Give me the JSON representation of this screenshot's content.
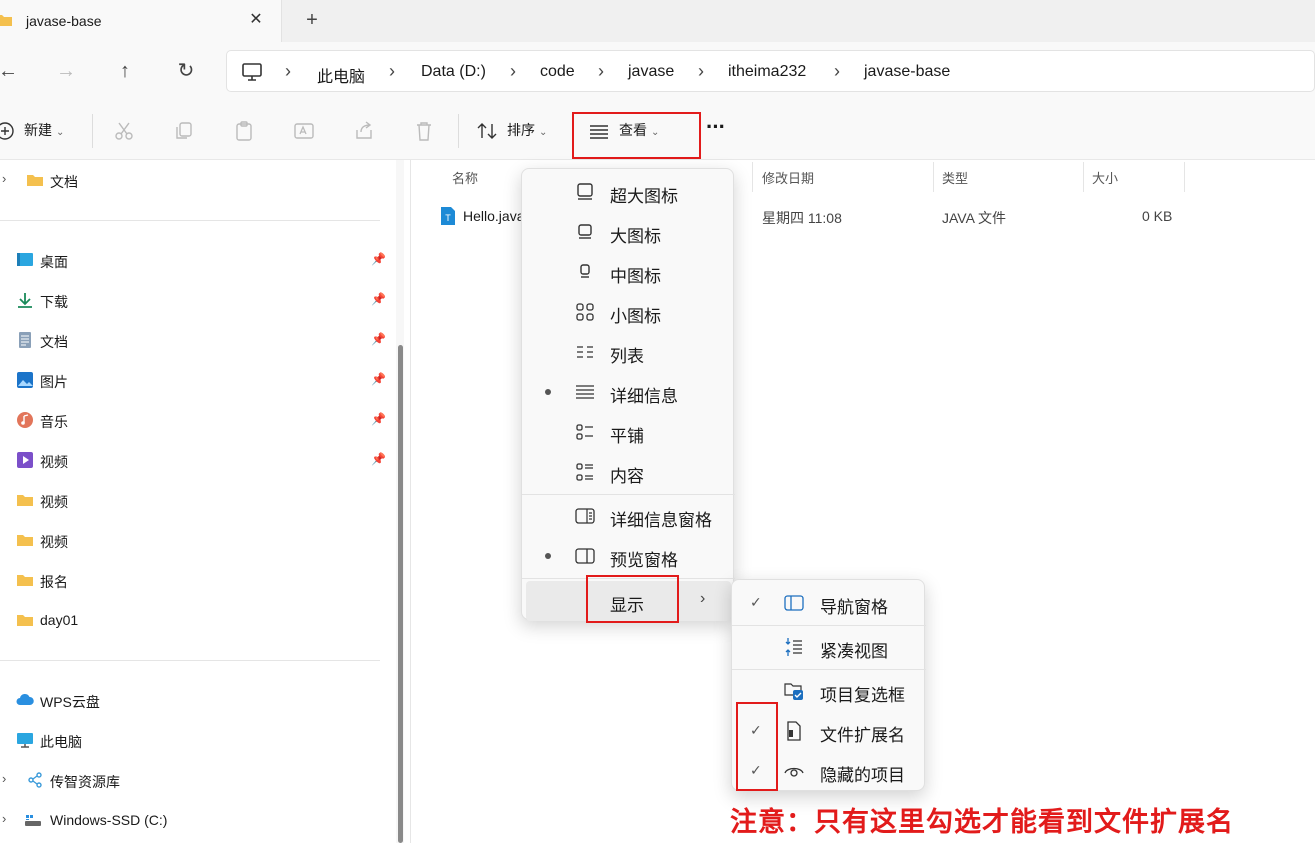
{
  "window": {
    "tab_title": "javase-base",
    "tab_close": "✕",
    "tab_new": "+"
  },
  "nav": {
    "back": "←",
    "forward": "→",
    "up": "↑",
    "refresh": "↻",
    "breadcrumbs": [
      "此电脑",
      "Data (D:)",
      "code",
      "javase",
      "itheima232",
      "javase-base"
    ],
    "separator": "›"
  },
  "toolbar": {
    "new_label": "新建",
    "sort_label": "排序",
    "view_label": "查看",
    "more": "···",
    "chevron": "⌄"
  },
  "sidebar": {
    "items": [
      {
        "label": "文档",
        "icon": "folder-icon"
      },
      {
        "label": "桌面",
        "icon": "desktop-icon"
      },
      {
        "label": "下载",
        "icon": "download-icon"
      },
      {
        "label": "文档",
        "icon": "document-icon"
      },
      {
        "label": "图片",
        "icon": "pictures-icon"
      },
      {
        "label": "音乐",
        "icon": "music-icon"
      },
      {
        "label": "视频",
        "icon": "video-icon"
      },
      {
        "label": "视频",
        "icon": "folder-icon"
      },
      {
        "label": "视频",
        "icon": "folder-icon"
      },
      {
        "label": "报名",
        "icon": "folder-icon"
      },
      {
        "label": "day01",
        "icon": "folder-icon"
      },
      {
        "label": "WPS云盘",
        "icon": "cloud-icon"
      },
      {
        "label": "此电脑",
        "icon": "computer-icon"
      },
      {
        "label": "传智资源库",
        "icon": "network-share-icon"
      },
      {
        "label": "Windows-SSD (C:)",
        "icon": "drive-icon"
      }
    ],
    "pin": "📌",
    "expand": "›"
  },
  "columns": {
    "name": "名称",
    "modified": "修改日期",
    "type": "类型",
    "size": "大小"
  },
  "files": [
    {
      "name": "Hello.java",
      "modified": "星期四 11:08",
      "type": "JAVA 文件",
      "size": "0 KB"
    }
  ],
  "view_menu": {
    "items": [
      "超大图标",
      "大图标",
      "中图标",
      "小图标",
      "列表",
      "详细信息",
      "平铺",
      "内容"
    ],
    "panes": [
      "详细信息窗格",
      "预览窗格"
    ],
    "show_label": "显示",
    "arrow": "›"
  },
  "show_menu": {
    "items": [
      "导航窗格",
      "紧凑视图",
      "项目复选框",
      "文件扩展名",
      "隐藏的项目"
    ],
    "check": "✓"
  },
  "annotation": {
    "note": "注意：只有这里勾选才能看到文件扩展名",
    "color": "#e21b1b"
  },
  "colors": {
    "accent": "#0067c0",
    "highlight": "#e21b1b"
  }
}
